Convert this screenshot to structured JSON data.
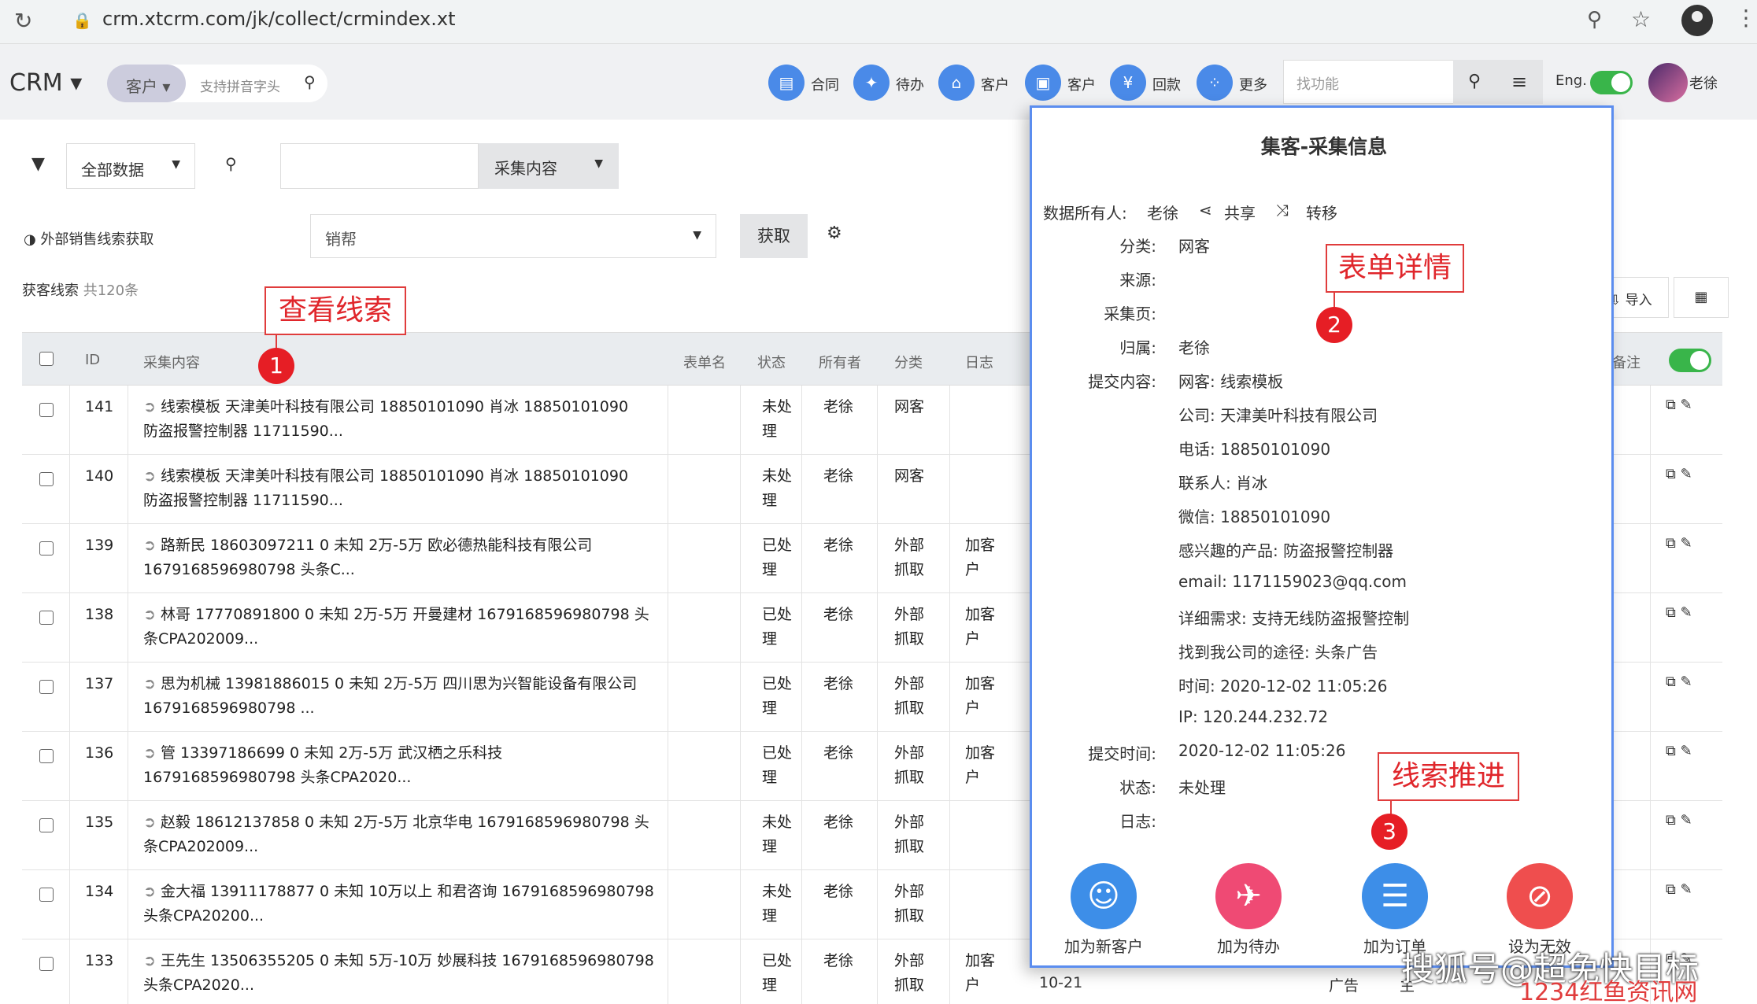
{
  "browser": {
    "url": "crm.xtcrm.com/jk/collect/crmindex.xt"
  },
  "header": {
    "brand": "CRM ▾",
    "search_seg": "客户 ▾",
    "search_placeholder": "支持拼音字头",
    "nav": [
      {
        "label": "合同",
        "icon": "contract-icon",
        "glyph": "▤"
      },
      {
        "label": "待办",
        "icon": "todo-runner-icon",
        "glyph": "✦"
      },
      {
        "label": "客户",
        "icon": "bank-icon",
        "glyph": "⌂"
      },
      {
        "label": "客户",
        "icon": "customer-box-icon",
        "glyph": "▣"
      },
      {
        "label": "回款",
        "icon": "yen-icon",
        "glyph": "¥"
      },
      {
        "label": "更多",
        "icon": "more-grid-icon",
        "glyph": "⁘"
      }
    ],
    "find_placeholder": "找功能",
    "lang": "Eng.",
    "user": "老徐"
  },
  "filters": {
    "scope": "全部数据",
    "content_btn": "采集内容",
    "external_label": "◑ 外部销售线索获取",
    "source_select": "销帮",
    "get_btn": "获取",
    "count_label": "获客线索",
    "count_value": "共120条",
    "import_btn": "⇩ 导入"
  },
  "table": {
    "headers": [
      "ID",
      "采集内容",
      "表单名",
      "状态",
      "所有者",
      "分类",
      "日志",
      "备注"
    ],
    "rows": [
      {
        "id": "141",
        "content": [
          "线索模板 天津美叶科技有限公司 18850101090 肖冰 18850101090",
          "防盗报警控制器 11711590..."
        ],
        "status": [
          "未处",
          "理"
        ],
        "owner": "老徐",
        "category": [
          "网客"
        ],
        "log": []
      },
      {
        "id": "140",
        "content": [
          "线索模板 天津美叶科技有限公司 18850101090 肖冰 18850101090",
          "防盗报警控制器 11711590..."
        ],
        "status": [
          "未处",
          "理"
        ],
        "owner": "老徐",
        "category": [
          "网客"
        ],
        "log": []
      },
      {
        "id": "139",
        "content": [
          "路新民 18603097211 0 未知 2万-5万 欧必德热能科技有限公司",
          "1679168596980798 头条C..."
        ],
        "status": [
          "已处",
          "理"
        ],
        "owner": "老徐",
        "category": [
          "外部",
          "抓取"
        ],
        "log": [
          "加客",
          "户"
        ]
      },
      {
        "id": "138",
        "content": [
          "林哥 17770891800 0 未知 2万-5万 开曼建材 1679168596980798 头",
          "条CPA202009..."
        ],
        "status": [
          "已处",
          "理"
        ],
        "owner": "老徐",
        "category": [
          "外部",
          "抓取"
        ],
        "log": [
          "加客",
          "户"
        ]
      },
      {
        "id": "137",
        "content": [
          "思为机械 13981886015 0 未知 2万-5万 四川思为兴智能设备有限公司",
          "1679168596980798 ..."
        ],
        "status": [
          "已处",
          "理"
        ],
        "owner": "老徐",
        "category": [
          "外部",
          "抓取"
        ],
        "log": [
          "加客",
          "户"
        ]
      },
      {
        "id": "136",
        "content": [
          "管 13397186699 0 未知 2万-5万 武汉栖之乐科技",
          "1679168596980798 头条CPA2020..."
        ],
        "status": [
          "已处",
          "理"
        ],
        "owner": "老徐",
        "category": [
          "外部",
          "抓取"
        ],
        "log": [
          "加客",
          "户"
        ]
      },
      {
        "id": "135",
        "content": [
          "赵毅 18612137858 0 未知 2万-5万 北京华电 1679168596980798 头",
          "条CPA202009..."
        ],
        "status": [
          "未处",
          "理"
        ],
        "owner": "老徐",
        "category": [
          "外部",
          "抓取"
        ],
        "log": []
      },
      {
        "id": "134",
        "content": [
          "金大福 13911178877 0 未知 10万以上 和君咨询 1679168596980798",
          "头条CPA20200..."
        ],
        "status": [
          "未处",
          "理"
        ],
        "owner": "老徐",
        "category": [
          "外部",
          "抓取"
        ],
        "log": []
      },
      {
        "id": "133",
        "content": [
          "王先生 13506355205 0 未知 5万-10万 妙展科技 1679168596980798",
          "头条CPA2020..."
        ],
        "status": [
          "已处",
          "理"
        ],
        "owner": "老徐",
        "category": [
          "外部",
          "抓取"
        ],
        "log": [
          "加客",
          "户"
        ]
      }
    ],
    "partial_date": "10-21",
    "partial_remark": "广告",
    "partial_col": "主"
  },
  "annotations": [
    {
      "label": "查看线索",
      "num": "1"
    },
    {
      "label": "表单详情",
      "num": "2"
    },
    {
      "label": "线索推进",
      "num": "3"
    }
  ],
  "popup": {
    "title": "集客-采集信息",
    "owner_label": "数据所有人:",
    "owner": "老徐",
    "share": "共享",
    "transfer": "转移",
    "fields": [
      {
        "k": "分类:",
        "v": "网客"
      },
      {
        "k": "来源:",
        "v": ""
      },
      {
        "k": "采集页:",
        "v": ""
      },
      {
        "k": "归属:",
        "v": "老徐"
      },
      {
        "k": "提交内容:",
        "v": "网客: 线索模板"
      }
    ],
    "submit_lines": [
      "公司: 天津美叶科技有限公司",
      "电话: 18850101090",
      "联系人: 肖冰",
      "微信: 18850101090",
      "感兴趣的产品: 防盗报警控制器",
      "email: 1171159023@qq.com",
      "详细需求: 支持无线防盗报警控制",
      "找到我公司的途径: 头条广告",
      "时间: 2020-12-02 11:05:26",
      "IP: 120.244.232.72"
    ],
    "fields2": [
      {
        "k": "提交时间:",
        "v": "2020-12-02 11:05:26"
      },
      {
        "k": "状态:",
        "v": "未处理"
      },
      {
        "k": "日志:",
        "v": ""
      }
    ],
    "actions": [
      {
        "label": "加为新客户",
        "color": "#3d8ee8",
        "glyph": "☺"
      },
      {
        "label": "加为待办",
        "color": "#ef4a74",
        "glyph": "✈"
      },
      {
        "label": "加为订单",
        "color": "#3d8ee8",
        "glyph": "☰"
      },
      {
        "label": "设为无效",
        "color": "#ef4e4e",
        "glyph": "⊘"
      }
    ]
  },
  "watermark": "搜狐号@超免快目标",
  "watermark2": "1234红鱼资讯网"
}
